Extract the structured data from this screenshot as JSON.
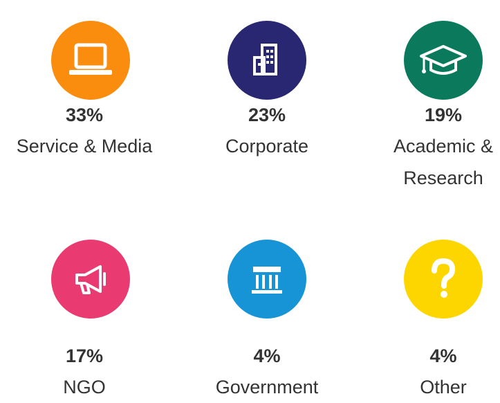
{
  "items": [
    {
      "percent": "33%",
      "label": "Service & Media",
      "color": "#FA8C0E",
      "icon": "laptop-icon"
    },
    {
      "percent": "23%",
      "label": "Corporate",
      "color": "#2A2772",
      "icon": "building-icon"
    },
    {
      "percent": "19%",
      "label_line1": "Academic &",
      "label_line2": "Research",
      "color": "#0B7A5C",
      "icon": "graduation-cap-icon"
    },
    {
      "percent": "17%",
      "label": "NGO",
      "color": "#E93B71",
      "icon": "megaphone-icon"
    },
    {
      "percent": "4%",
      "label": "Government",
      "color": "#1794D5",
      "icon": "government-building-icon"
    },
    {
      "percent": "4%",
      "label": "Other",
      "color": "#FDD600",
      "icon": "question-mark-icon"
    }
  ]
}
